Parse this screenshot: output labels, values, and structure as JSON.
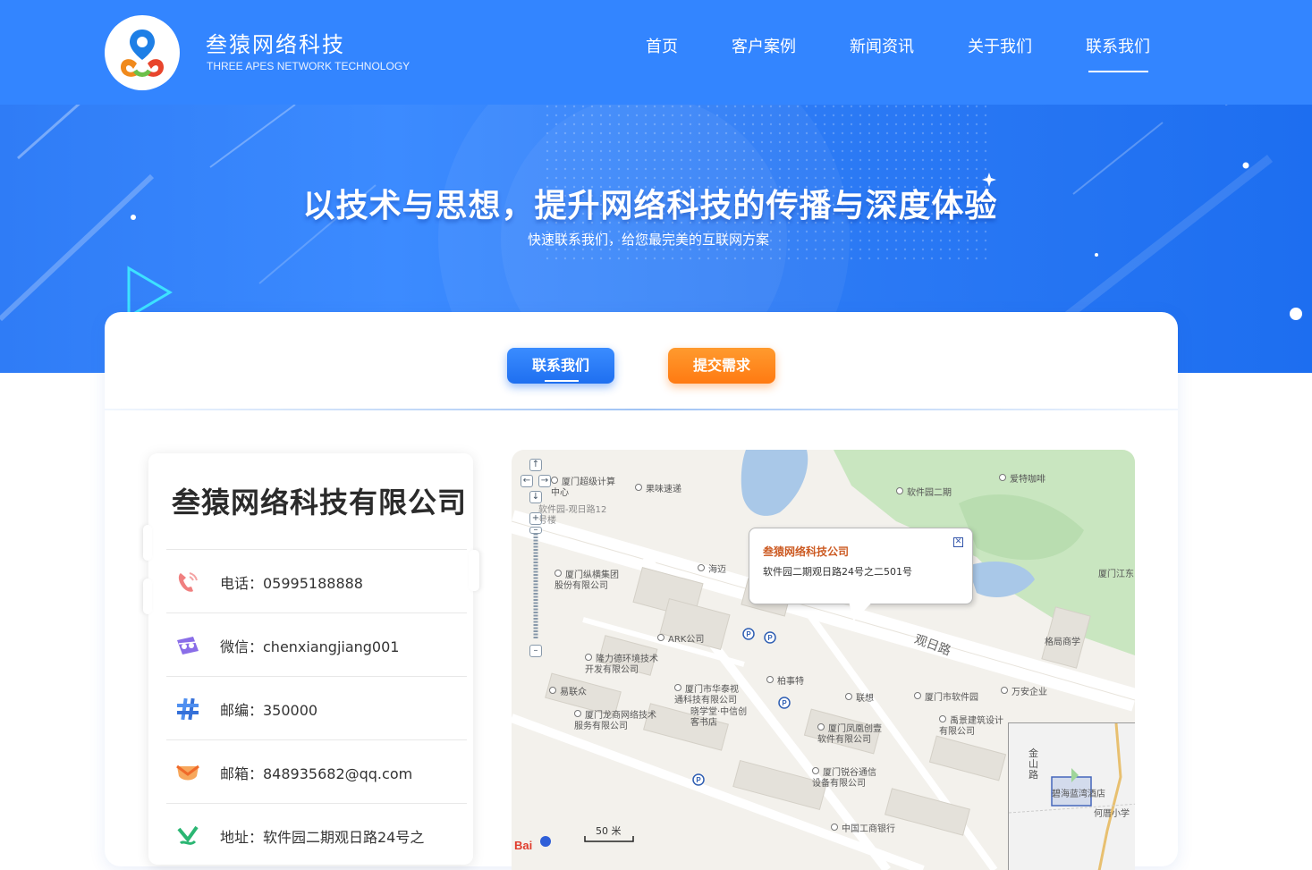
{
  "brand": {
    "name": "叁猿网络科技",
    "subtitle": "THREE APES NETWORK TECHNOLOGY"
  },
  "nav": {
    "items": [
      {
        "label": "首页"
      },
      {
        "label": "客户案例"
      },
      {
        "label": "新闻资讯"
      },
      {
        "label": "关于我们"
      },
      {
        "label": "联系我们",
        "active": true
      }
    ]
  },
  "banner": {
    "title": "以技术与思想，提升网络科技的传播与深度体验",
    "subtitle": "快速联系我们，给您最完美的互联网方案"
  },
  "tabs": {
    "contact_label": "联系我们",
    "submit_label": "提交需求"
  },
  "company": {
    "name": "叁猿网络科技有限公司",
    "rows": [
      {
        "text": "电话：05995188888",
        "icon": "phone-icon"
      },
      {
        "text": "微信：chenxiangjiang001",
        "icon": "wechat-icon"
      },
      {
        "text": "邮编：350000",
        "icon": "hash-icon"
      },
      {
        "text": "邮箱：848935682@qq.com",
        "icon": "mail-icon"
      },
      {
        "text": "地址：软件园二期观日路24号之",
        "icon": "address-icon"
      }
    ]
  },
  "map": {
    "popup_title": "叁猿网络科技公司",
    "popup_address": "软件园二期观日路24号之二501号",
    "scale": "50 米",
    "road_name": "观日路",
    "labels": [
      "厦门超级计算中心",
      "软件园-观日路12号楼",
      "果味速递",
      "软件园二期",
      "爱特咖啡",
      "海迈",
      "厦门纵横集团股份有限公司",
      "ARK公司",
      "隆力德环境技术开发有限公司",
      "易联众",
      "厦门市华泰视通科技有限公司",
      "晓学堂·中信创客书店",
      "厦门龙商网络技术服务有限公司",
      "柏事特",
      "联想",
      "厦门市软件园",
      "万安企业",
      "厦门江东",
      "格局商学",
      "厦门凤凰创壹软件有限公司",
      "禹景建筑设计有限公司",
      "厦门锐谷通信设备有限公司",
      "中国工商银行",
      "金山路",
      "碧海蓝湾酒店",
      "何厝小学"
    ]
  },
  "colors": {
    "primary": "#3385ff",
    "accent_orange": "#ff7a12",
    "popup_title": "#cc5a22"
  }
}
